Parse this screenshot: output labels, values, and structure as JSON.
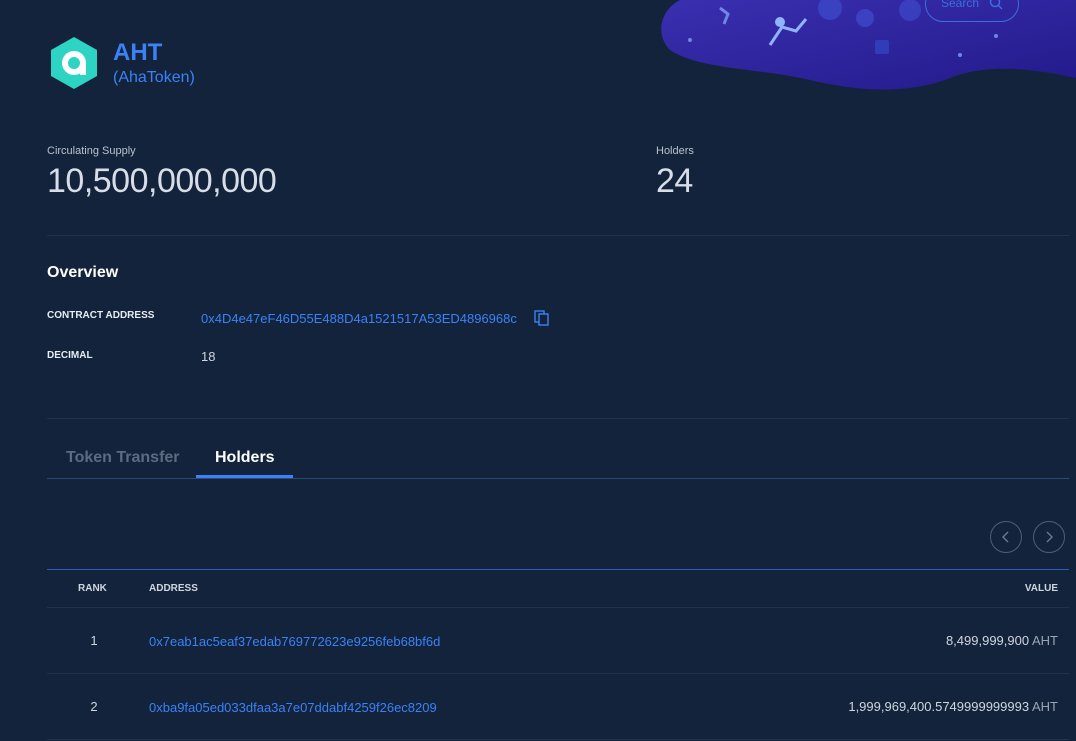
{
  "header": {
    "search_label": "Search"
  },
  "token": {
    "symbol": "AHT",
    "name": "(AhaToken)",
    "logo_color": "#2dd4c4"
  },
  "stats": {
    "supply_label": "Circulating Supply",
    "supply_value": "10,500,000,000",
    "holders_label": "Holders",
    "holders_value": "24"
  },
  "overview": {
    "title": "Overview",
    "contract_label": "CONTRACT ADDRESS",
    "contract_value": "0x4D4e47eF46D55E488D4a1521517A53ED4896968c",
    "decimal_label": "DECIMAL",
    "decimal_value": "18"
  },
  "tabs": [
    {
      "label": "Token Transfer",
      "active": false
    },
    {
      "label": "Holders",
      "active": true
    }
  ],
  "table": {
    "headers": {
      "rank": "RANK",
      "address": "ADDRESS",
      "value": "VALUE"
    },
    "rows": [
      {
        "rank": "1",
        "address": "0x7eab1ac5eaf37edab769772623e9256feb68bf6d",
        "value": "8,499,999,900",
        "unit": "AHT"
      },
      {
        "rank": "2",
        "address": "0xba9fa05ed033dfaa3a7e07ddabf4259f26ec8209",
        "value": "1,999,969,400.5749999999993",
        "unit": "AHT"
      }
    ]
  },
  "colors": {
    "background": "#13233b",
    "accent": "#3b82f6",
    "logo": "#2dd4c4"
  }
}
